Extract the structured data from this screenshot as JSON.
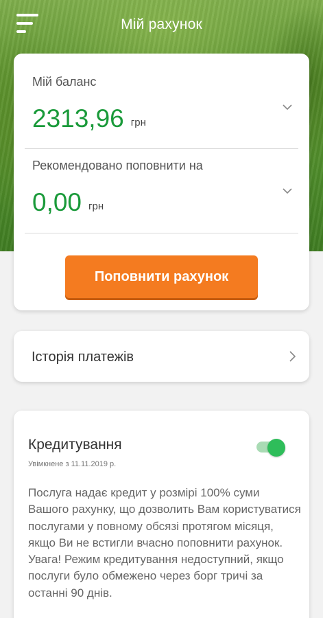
{
  "header": {
    "title": "Мій рахунок",
    "menu_icon": "hamburger-menu-icon"
  },
  "balance": {
    "label": "Мій баланс",
    "amount": "2313,96",
    "currency": "грн"
  },
  "recommended": {
    "label": "Рекомендовано поповнити на",
    "amount": "0,00",
    "currency": "грн"
  },
  "topup_button": "Поповнити рахунок",
  "history": {
    "label": "Історія платежів"
  },
  "credit": {
    "title": "Кредитування",
    "status": "Увімкнене з 11.11.2019 р.",
    "enabled": true,
    "description": "Послуга надає кредит у розмірі 100% суми Вашого рахунку, що дозволить Вам користуватися послугами у повному обсязі протягом місяця, якщо Ви не встигли вчасно поповнити рахунок. Увага! Режим кредитування недоступний, якщо послуги було обмежено через борг тричі за останні 90 днів."
  },
  "colors": {
    "accent_green": "#1a9a3a",
    "button_orange": "#f47b20",
    "toggle_on": "#2ebd5a"
  }
}
